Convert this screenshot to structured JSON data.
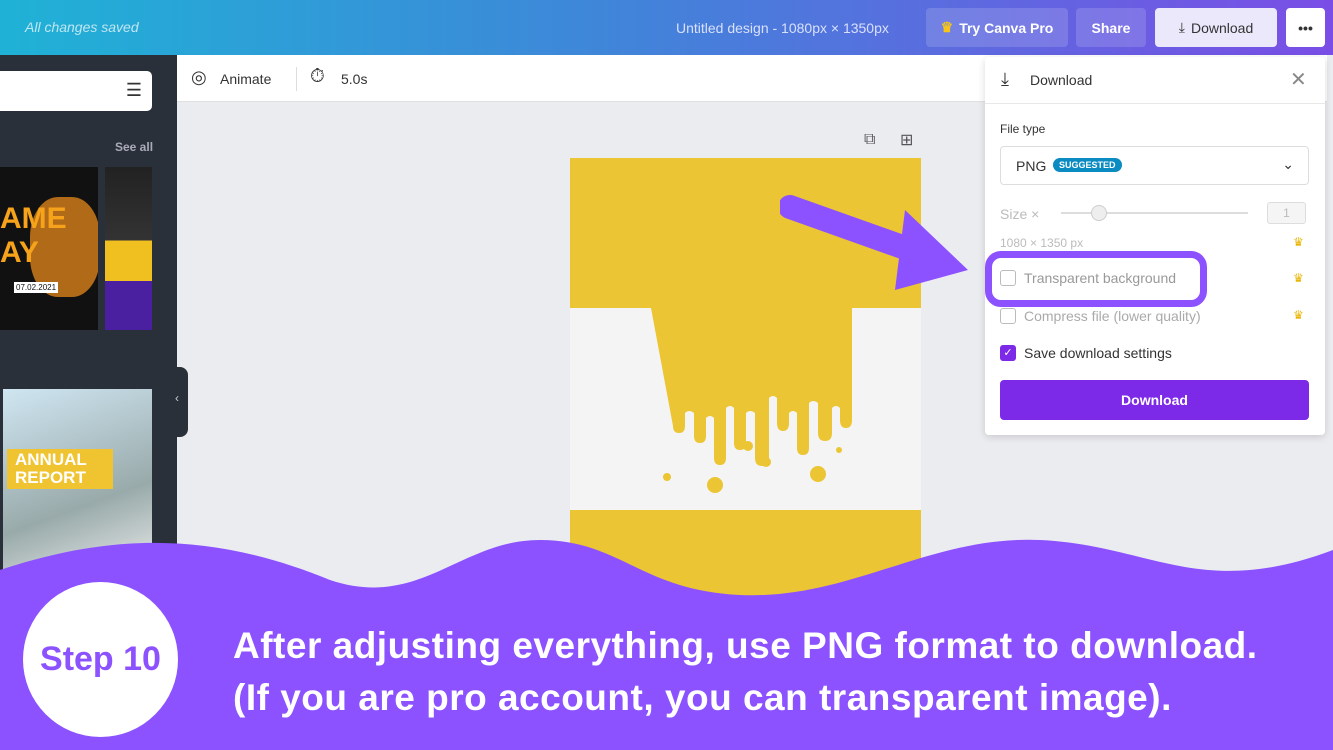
{
  "topbar": {
    "status": "All changes saved",
    "title": "Untitled design - 1080px × 1350px",
    "try_pro": "Try Canva Pro",
    "share": "Share",
    "download": "Download",
    "more": "•••"
  },
  "sidebar": {
    "see_all": "See all",
    "thumb1_title": "AME AY",
    "thumb1_date": "07.02.2021",
    "thumb2_title": "ANNUAL REPORT"
  },
  "toolbar": {
    "animate": "Animate",
    "duration": "5.0s"
  },
  "download_panel": {
    "title": "Download",
    "file_type_label": "File type",
    "file_type": "PNG",
    "badge": "SUGGESTED",
    "size_label": "Size ×",
    "size_value": "1",
    "size_slider_fraction": 0.2,
    "dimensions": "1080 × 1350 px",
    "transparent": "Transparent background",
    "transparent_checked": false,
    "compress": "Compress file (lower quality)",
    "compress_checked": false,
    "save_settings": "Save download settings",
    "save_settings_checked": true,
    "download_button": "Download"
  },
  "colors": {
    "accent": "#7d2ae8",
    "highlight": "#8c52ff",
    "design_yellow": "#ecc534"
  },
  "tutorial": {
    "step": "Step 10",
    "line1": "After adjusting everything, use PNG format to download.",
    "line2": "(If you are pro account, you can transparent image)."
  }
}
